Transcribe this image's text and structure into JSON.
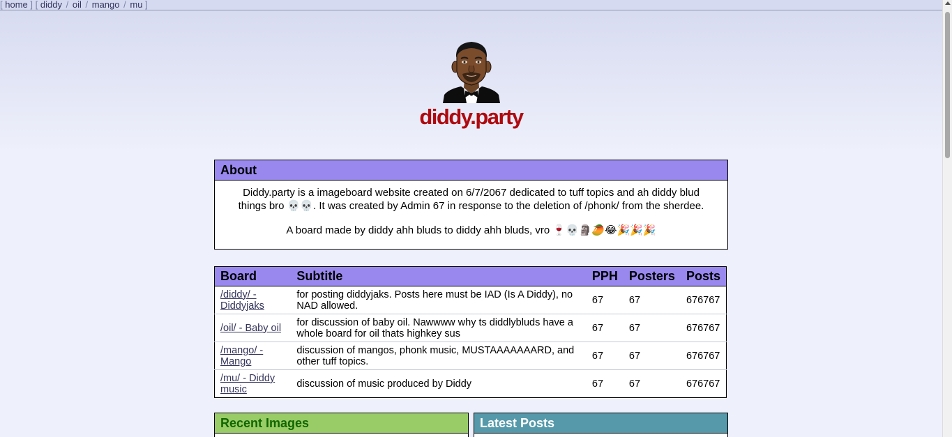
{
  "nav": {
    "open": "[",
    "close": "]",
    "home": "home",
    "boards": [
      "diddy",
      "oil",
      "mango",
      "mu"
    ],
    "sep": "/"
  },
  "site": {
    "title": "diddy.party",
    "logo_icon": "diddy-cartoon-avatar"
  },
  "about": {
    "heading": "About",
    "paragraph1": "Diddy.party is a imageboard website created on 6/7/2067 dedicated to tuff topics and ah diddy blud things bro 💀💀. It was created by Admin 67 in response to the deletion of /phonk/ from the sherdee.",
    "paragraph2": "A board made by diddy ahh bluds to diddy ahh bluds, vro 🍷💀🗿🥭😂🎉🎉🎉"
  },
  "boards_table": {
    "headers": {
      "board": "Board",
      "subtitle": "Subtitle",
      "pph": "PPH",
      "posters": "Posters",
      "posts": "Posts"
    },
    "rows": [
      {
        "board": "/diddy/ - Diddyjaks",
        "subtitle": "for posting diddyjaks. Posts here must be IAD (Is A Diddy), no NAD allowed.",
        "pph": "67",
        "posters": "67",
        "posts": "676767"
      },
      {
        "board": "/oil/ - Baby oil",
        "subtitle": "for discussion of baby oil. Nawwww why ts diddlybluds have a whole board for oil thats highkey sus",
        "pph": "67",
        "posters": "67",
        "posts": "676767"
      },
      {
        "board": "/mango/ - Mango",
        "subtitle": "discussion of mangos, phonk music, MUSTAAAAAAARD, and other tuff topics.",
        "pph": "67",
        "posters": "67",
        "posts": "676767"
      },
      {
        "board": "/mu/ - Diddy music",
        "subtitle": "discussion of music produced by Diddy",
        "pph": "67",
        "posters": "67",
        "posts": "676767"
      }
    ]
  },
  "recent_images": {
    "heading": "Recent Images"
  },
  "latest_posts": {
    "heading": "Latest Posts"
  },
  "colors": {
    "title_red": "#af0a0f",
    "header_purple": "#9988ee",
    "recent_green": "#99cc66",
    "latest_teal": "#5599aa",
    "link": "#34345c"
  }
}
